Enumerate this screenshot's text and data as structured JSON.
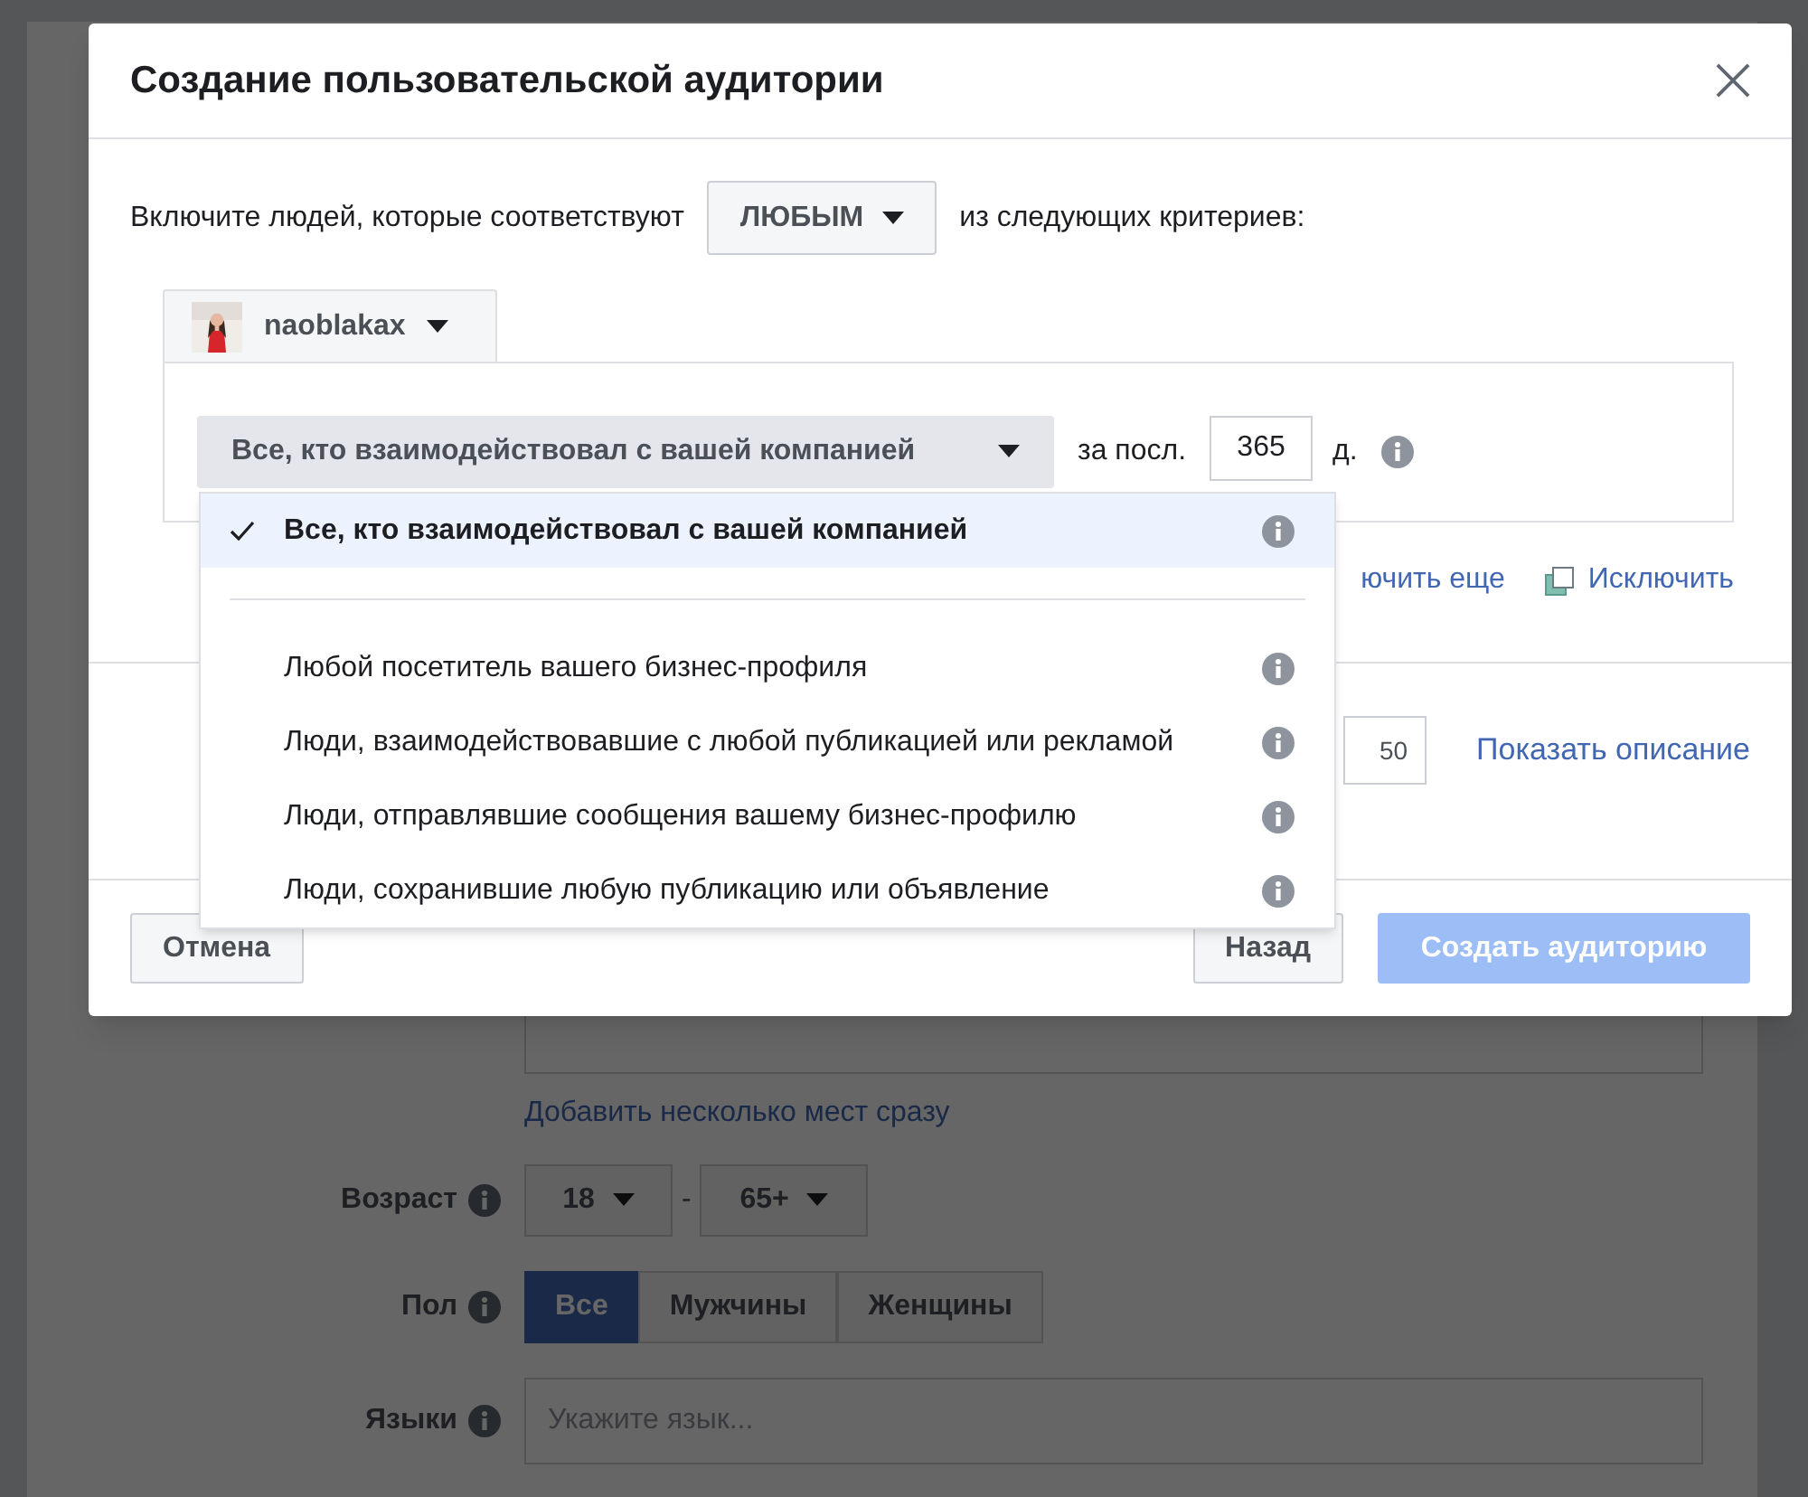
{
  "background": {
    "link": "Добавить несколько мест сразу",
    "age": {
      "label": "Возраст",
      "from": "18",
      "separator": "-",
      "to": "65+"
    },
    "gender": {
      "label": "Пол",
      "options": [
        {
          "label": "Все",
          "selected": true
        },
        {
          "label": "Мужчины",
          "selected": false
        },
        {
          "label": "Женщины",
          "selected": false
        }
      ]
    },
    "languages": {
      "label": "Языки",
      "placeholder": "Укажите язык..."
    }
  },
  "dialog": {
    "title": "Создание пользовательской аудитории",
    "criteria": {
      "prefix": "Включите людей, которые соответствуют",
      "match": "ЛЮБЫМ",
      "suffix": "из следующих критериев:"
    },
    "source": {
      "name": "naoblakax"
    },
    "rule": {
      "event": "Все, кто взаимодействовал с вашей компанией",
      "period_label": "за посл.",
      "days": "365",
      "unit": "д."
    },
    "menu": [
      {
        "label": "Все, кто взаимодействовал с вашей компанией",
        "selected": true
      },
      {
        "label": "Любой посетитель вашего бизнес-профиля",
        "selected": false
      },
      {
        "label": "Люди, взаимодействовавшие с любой публикацией или рекламой",
        "selected": false
      },
      {
        "label": "Люди, отправлявшие сообщения вашему бизнес-профилю",
        "selected": false
      },
      {
        "label": "Люди, сохранившие любую публикацию или объявление",
        "selected": false
      }
    ],
    "links": {
      "include_more": "ючить еще",
      "exclude": "Исключить"
    },
    "retention": "50",
    "show_description": "Показать описание",
    "buttons": {
      "cancel": "Отмена",
      "back": "Назад",
      "create": {
        "label": "Создать аудиторию",
        "disabled": true
      }
    }
  }
}
